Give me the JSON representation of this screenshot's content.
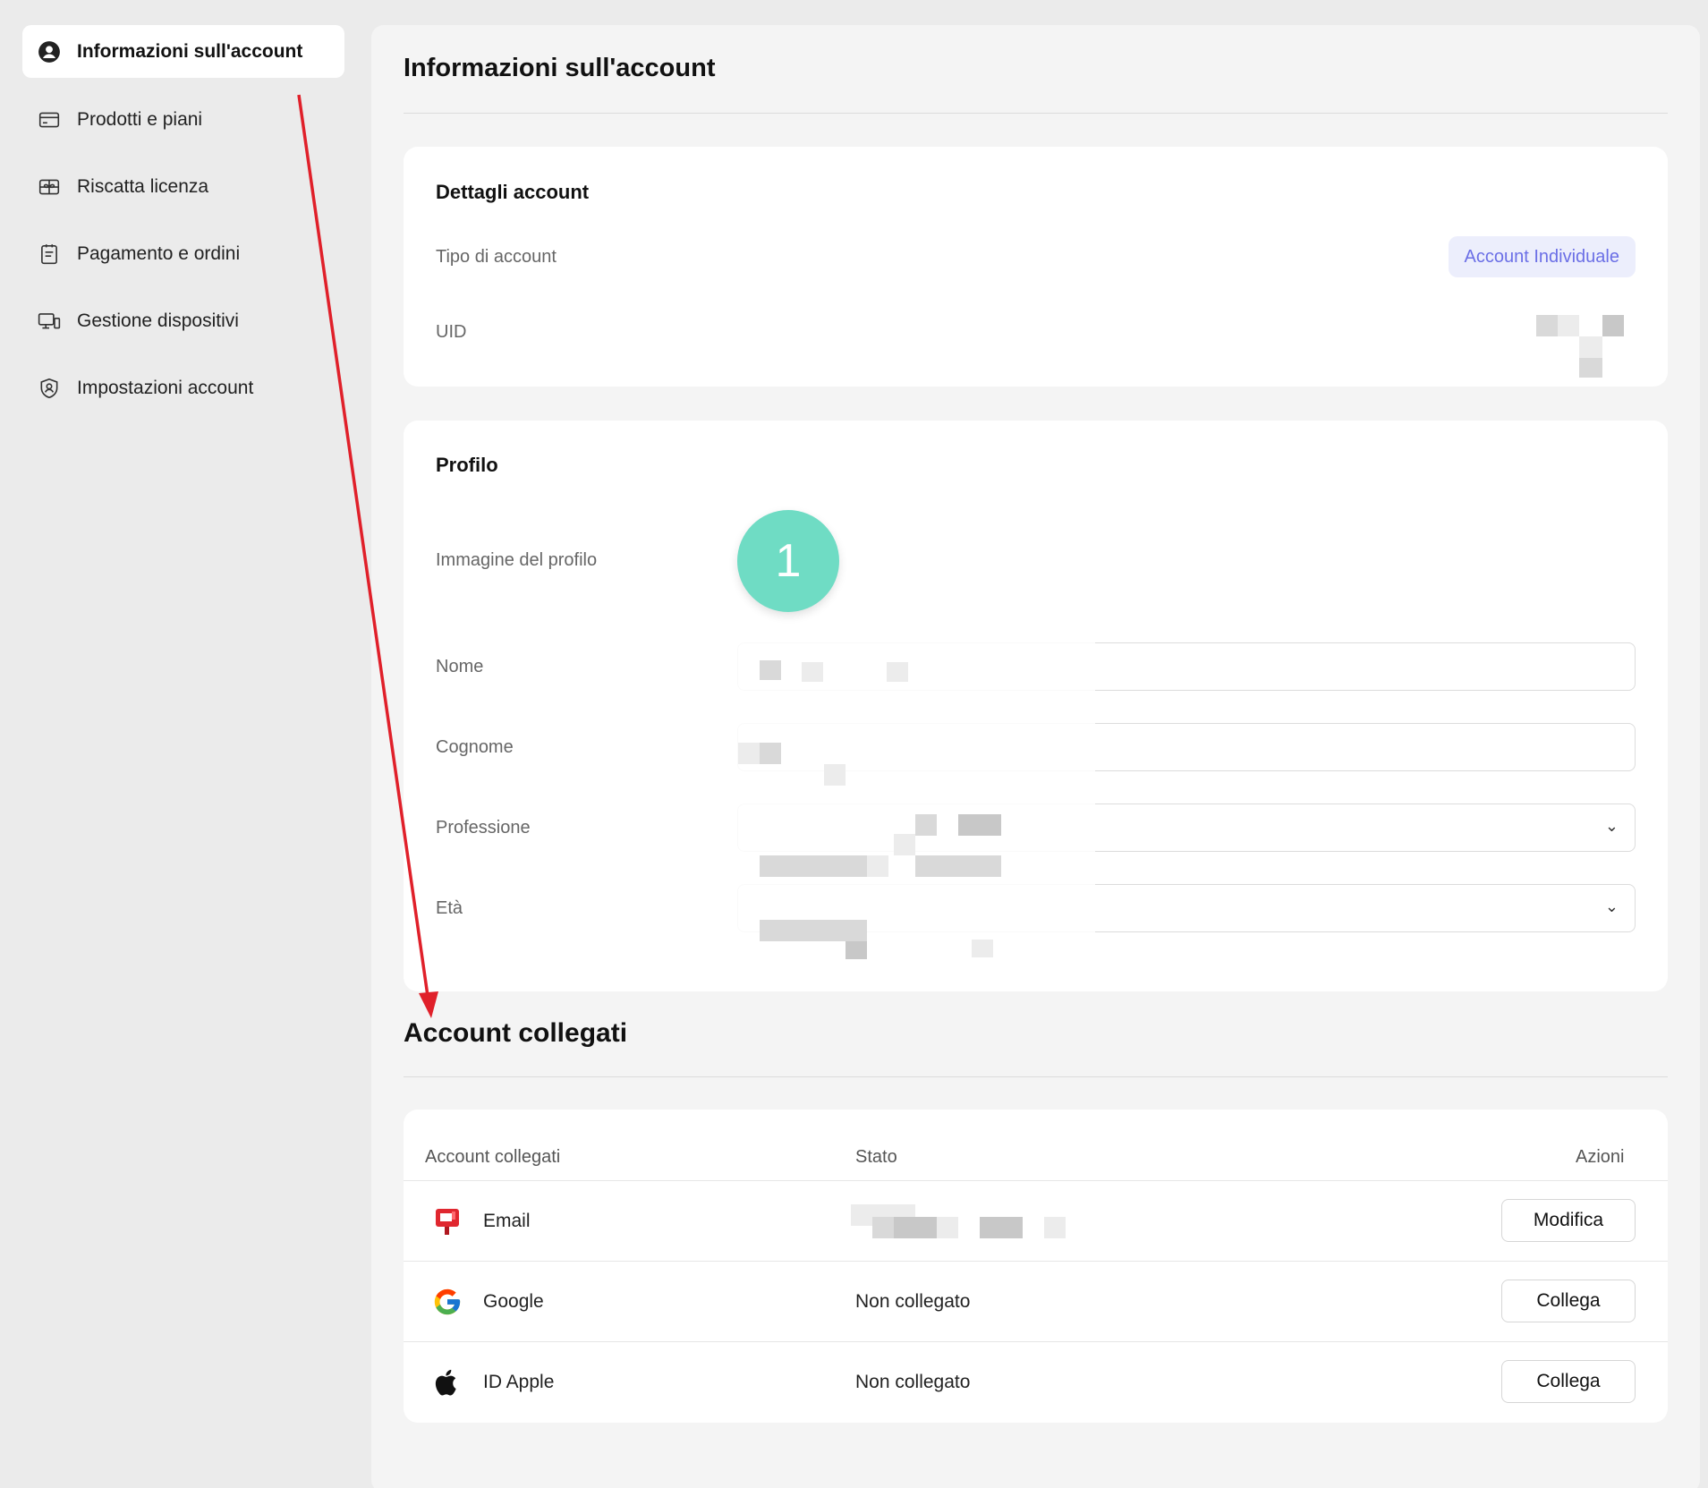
{
  "sidebar": {
    "items": [
      {
        "label": "Informazioni sull'account",
        "icon": "user-circle-icon",
        "active": true
      },
      {
        "label": "Prodotti e piani",
        "icon": "card-icon"
      },
      {
        "label": "Riscatta licenza",
        "icon": "gift-icon"
      },
      {
        "label": "Pagamento e ordini",
        "icon": "clipboard-icon"
      },
      {
        "label": "Gestione dispositivi",
        "icon": "devices-icon"
      },
      {
        "label": "Impostazioni account",
        "icon": "shield-user-icon"
      }
    ]
  },
  "main": {
    "title": "Informazioni sull'account",
    "account_details": {
      "title": "Dettagli account",
      "type_label": "Tipo di account",
      "type_value": "Account Individuale",
      "uid_label": "UID"
    },
    "profile": {
      "title": "Profilo",
      "image_label": "Immagine del profilo",
      "avatar_text": "1",
      "avatar_color": "#6fdcc4",
      "fields": [
        {
          "label": "Nome"
        },
        {
          "label": "Cognome"
        },
        {
          "label": "Professione"
        },
        {
          "label": "Età"
        }
      ]
    },
    "linked": {
      "title": "Account collegati",
      "headers": {
        "account": "Account collegati",
        "status": "Stato",
        "actions": "Azioni"
      },
      "rows": [
        {
          "name": "Email",
          "icon": "mailbox-icon",
          "status": "",
          "action": "Modifica"
        },
        {
          "name": "Google",
          "icon": "google-icon",
          "status": "Non collegato",
          "action": "Collega"
        },
        {
          "name": "ID Apple",
          "icon": "apple-icon",
          "status": "Non collegato",
          "action": "Collega"
        }
      ]
    }
  },
  "colors": {
    "badge_text": "#6b6fe6",
    "badge_bg": "#eceefc",
    "annotation_arrow": "#e0202a"
  }
}
